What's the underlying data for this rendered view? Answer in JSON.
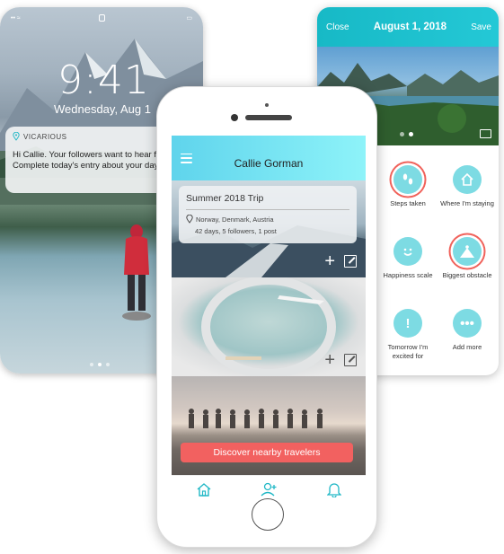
{
  "lock_screen": {
    "time": "9:41",
    "date": "Wednesday, Aug 1",
    "notification": {
      "app_name": "VICARIOUS",
      "line1": "Hi Callie. Your followers want to hear fr",
      "line2": "Complete today's entry about your day"
    }
  },
  "entry_screen": {
    "close_label": "Close",
    "title": "August 1, 2018",
    "save_label": "Save",
    "prompts": [
      {
        "label": "Steps taken",
        "icon": "footprints-icon",
        "selected": true
      },
      {
        "label": "Where I'm staying",
        "icon": "house-icon",
        "selected": false
      },
      {
        "label": "Happiness scale",
        "icon": "smiley-icon",
        "selected": false
      },
      {
        "label": "Biggest obstacle",
        "icon": "climber-icon",
        "selected": true
      },
      {
        "label": "Tomorrow I'm excited for",
        "icon": "exclamation-icon",
        "selected": false
      },
      {
        "label": "Add more",
        "icon": "more-icon",
        "selected": false
      }
    ],
    "accent_color": "#1bbfcc",
    "highlight_ring_color": "#f0625b"
  },
  "main_screen": {
    "user_name": "Callie Gorman",
    "trip": {
      "title": "Summer 2018 Trip",
      "countries": "Norway, Denmark, Austria",
      "stats": "42 days, 5 followers, 1 post"
    },
    "discover_label": "Discover nearby travelers",
    "tabs": [
      "home-icon",
      "add-friend-icon",
      "bell-icon"
    ],
    "cta_color": "#f26160"
  }
}
